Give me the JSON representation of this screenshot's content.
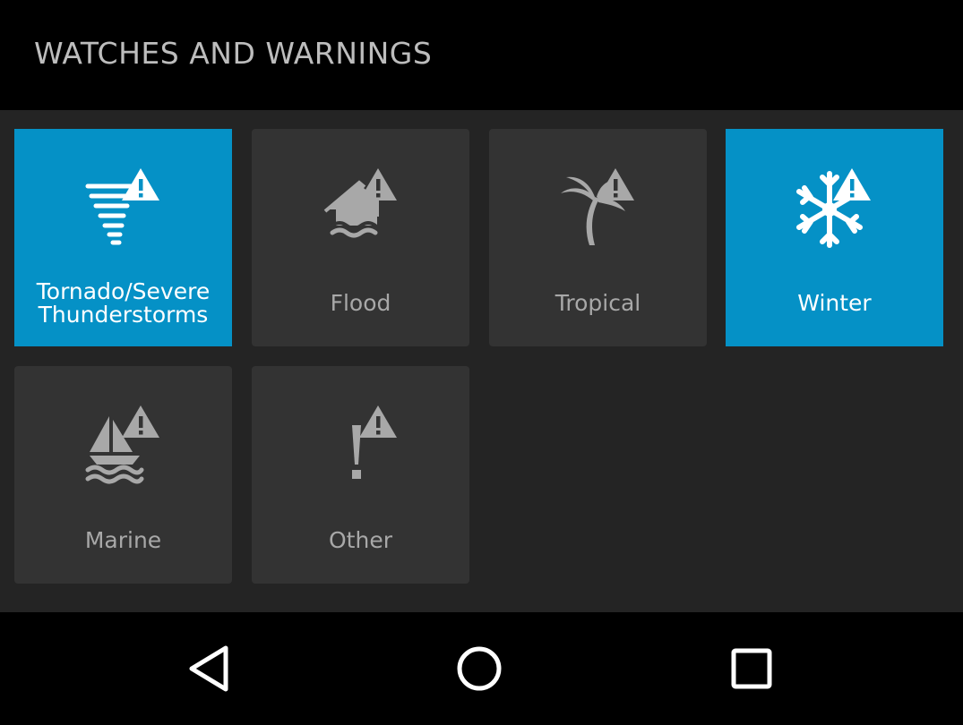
{
  "header": {
    "title": "WATCHES AND WARNINGS"
  },
  "tiles": [
    {
      "label_line1": "Tornado/Severe",
      "label_line2": "Thunderstorms",
      "icon": "tornado-warning-icon",
      "selected": true
    },
    {
      "label": "Flood",
      "icon": "flood-warning-icon",
      "selected": false
    },
    {
      "label": "Tropical",
      "icon": "tropical-warning-icon",
      "selected": false
    },
    {
      "label": "Winter",
      "icon": "winter-warning-icon",
      "selected": true
    },
    {
      "label": "Marine",
      "icon": "marine-warning-icon",
      "selected": false
    },
    {
      "label": "Other",
      "icon": "other-warning-icon",
      "selected": false
    }
  ],
  "navbar": {
    "back_icon": "back-triangle-icon",
    "home_icon": "home-circle-icon",
    "recents_icon": "recents-square-icon"
  },
  "colors": {
    "selected_tile": "#0591c6",
    "tile": "#333333",
    "content_bg": "#242424",
    "header_bg": "#000000",
    "header_text": "#bdbdbd",
    "tile_text": "#a8a8a8"
  }
}
